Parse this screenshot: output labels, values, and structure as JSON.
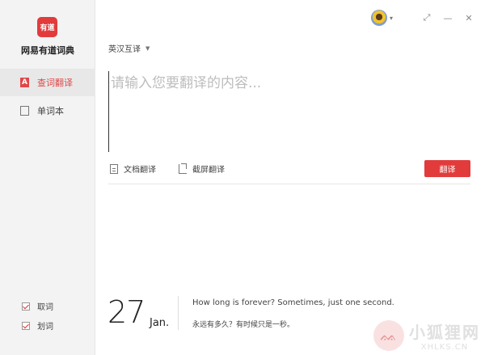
{
  "app": {
    "logo_text": "有道",
    "name": "网易有道词典"
  },
  "sidebar": {
    "items": [
      {
        "label": "查词翻译",
        "icon": "a-translate-icon",
        "active": true
      },
      {
        "label": "单词本",
        "icon": "book-icon",
        "active": false
      }
    ],
    "options": [
      {
        "label": "取词",
        "checked": true
      },
      {
        "label": "划词",
        "checked": true
      }
    ]
  },
  "window": {
    "restore": "⤢",
    "minimize": "—",
    "close": "✕",
    "caret": "▾"
  },
  "translate": {
    "language": "英汉互译",
    "language_caret": "▼",
    "placeholder": "请输入您要翻译的内容...",
    "doc_label": "文档翻译",
    "screenshot_label": "截屏翻译",
    "button_label": "翻译"
  },
  "daily": {
    "day": "27",
    "month": "Jan.",
    "quote_en": "How long is forever? Sometimes, just one second.",
    "quote_cn": "永远有多久？有时候只是一秒。"
  },
  "watermark": {
    "cn": "小狐狸网",
    "en": "XHLKS.CN"
  },
  "colors": {
    "accent": "#e23b3b"
  }
}
